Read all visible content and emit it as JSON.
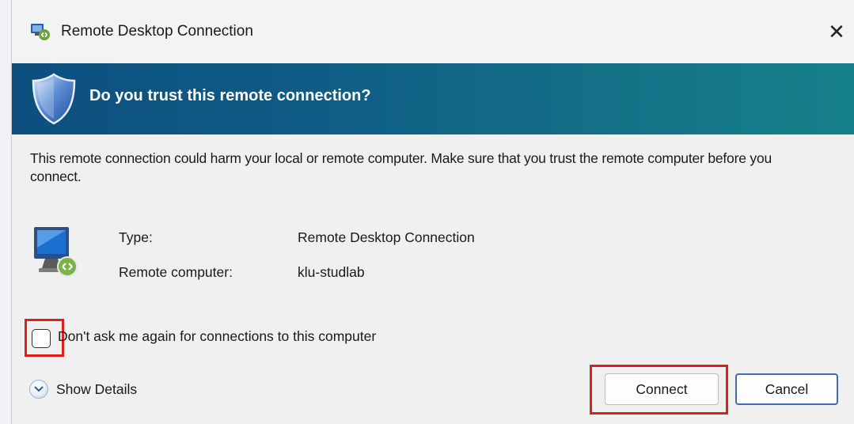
{
  "window": {
    "title": "Remote Desktop Connection",
    "close_glyph": "✕",
    "icon": "remote-desktop-icon"
  },
  "banner": {
    "heading": "Do you trust this remote connection?",
    "icon": "shield-icon"
  },
  "warning_text": "This remote connection could harm your local or remote computer. Make sure that you trust the remote computer before you connect.",
  "info": {
    "icon": "remote-computer-icon",
    "type_label": "Type:",
    "type_value": "Remote Desktop Connection",
    "computer_label": "Remote computer:",
    "computer_value": "klu-studlab"
  },
  "checkbox": {
    "label": "Don't ask me again for connections to this computer",
    "checked": false
  },
  "details": {
    "label": "Show Details",
    "icon": "chevron-down-circle-icon"
  },
  "buttons": {
    "connect": "Connect",
    "cancel": "Cancel"
  },
  "colors": {
    "banner_start": "#0d4f7e",
    "banner_end": "#16818a",
    "highlight": "#e11d1d",
    "default_button_border": "#3b6fb3"
  }
}
